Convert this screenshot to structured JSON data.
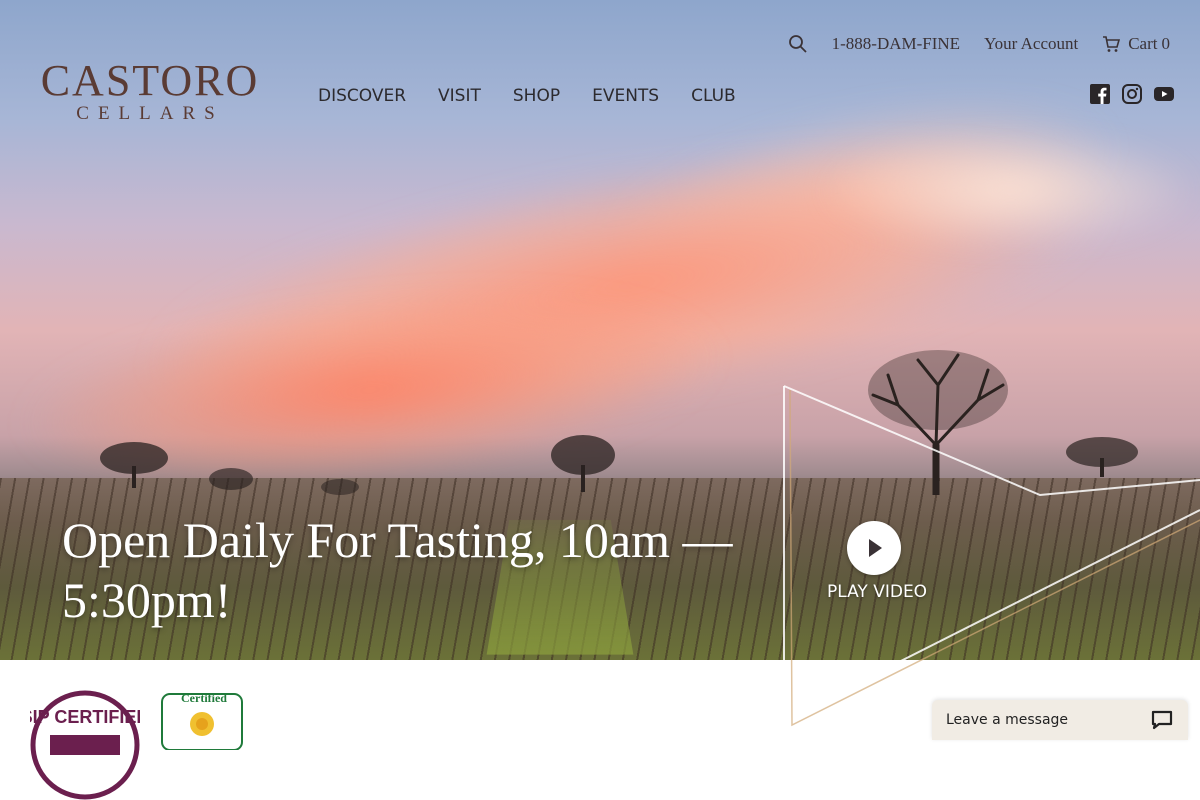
{
  "logo": {
    "main": "CASTORO",
    "sub": "CELLARS"
  },
  "nav": {
    "items": [
      {
        "label": "DISCOVER"
      },
      {
        "label": "VISIT"
      },
      {
        "label": "SHOP"
      },
      {
        "label": "EVENTS"
      },
      {
        "label": "CLUB"
      }
    ]
  },
  "topbar": {
    "search_icon": "search-icon",
    "phone": "1-888-DAM-FINE",
    "account": "Your Account",
    "cart_label": "Cart",
    "cart_count": "0"
  },
  "social": {
    "icons": [
      "facebook-icon",
      "instagram-icon",
      "youtube-icon"
    ]
  },
  "hero": {
    "headline": "Open Daily For Tasting, 10am — 5:30pm!",
    "video_label": "PLAY VIDEO"
  },
  "badges": {
    "sip": "SIP CERTIFIED",
    "cert": "Certified"
  },
  "chat": {
    "label": "Leave a message"
  },
  "colors": {
    "brand": "#5a3b34",
    "nav_text": "#2c2a2e",
    "sip_purple": "#6b1f4e",
    "cert_green": "#1f7a3a",
    "chat_bg": "#f1ece4"
  }
}
